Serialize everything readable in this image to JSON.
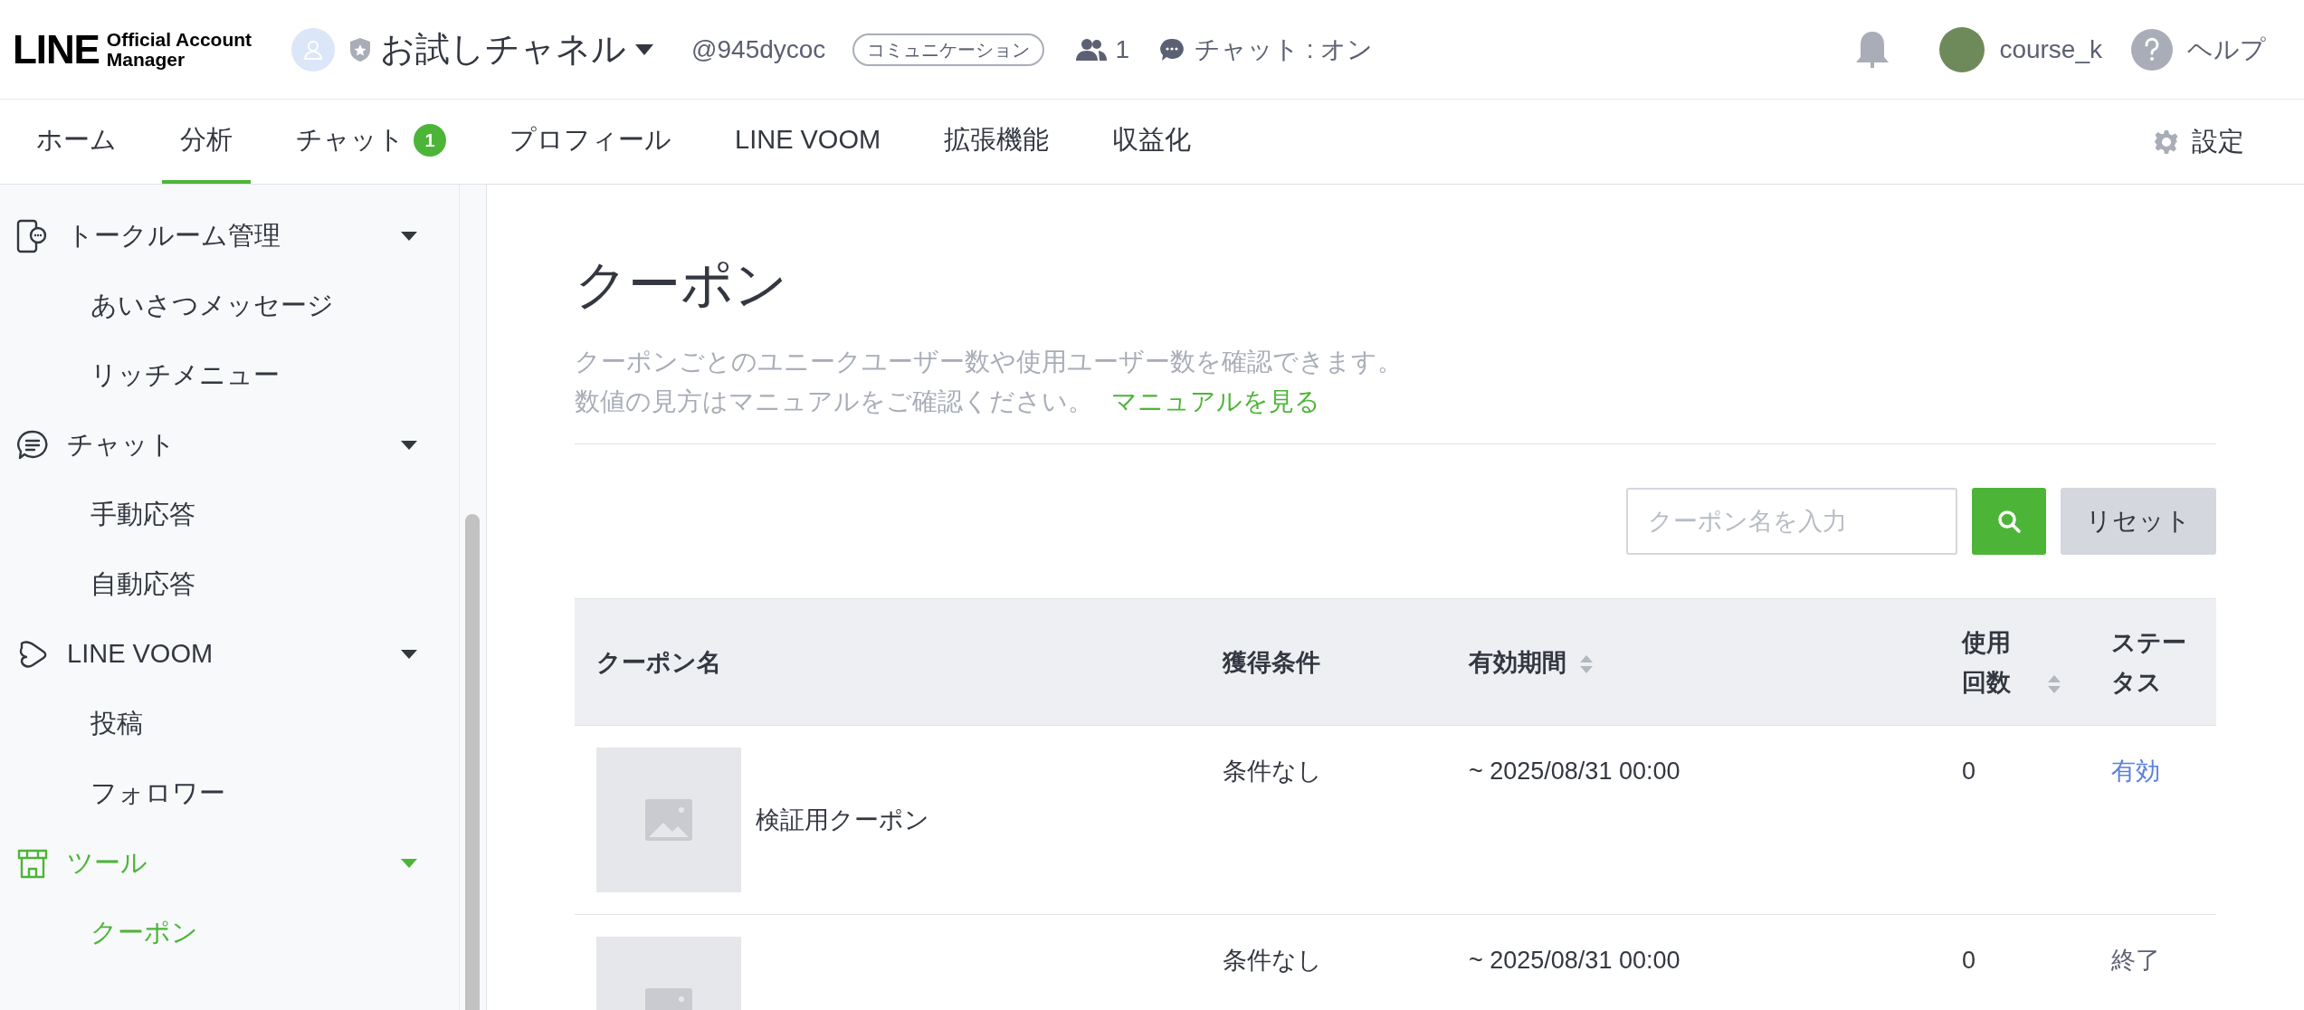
{
  "header": {
    "logo": {
      "mark": "LINE",
      "line1": "Official Account",
      "line2": "Manager"
    },
    "account": {
      "name": "お試しチャネル",
      "id": "@945dycoc",
      "plan": "コミュニケーション"
    },
    "friends": "1",
    "chat_status": "チャット : オン",
    "user": "course_k",
    "help": "ヘルプ"
  },
  "nav": {
    "tabs": [
      {
        "label": "ホーム",
        "selected": false
      },
      {
        "label": "分析",
        "selected": true
      },
      {
        "label": "チャット",
        "selected": false,
        "badge": "1"
      },
      {
        "label": "プロフィール",
        "selected": false
      },
      {
        "label": "LINE VOOM",
        "selected": false
      },
      {
        "label": "拡張機能",
        "selected": false
      },
      {
        "label": "収益化",
        "selected": false
      }
    ],
    "settings": "設定"
  },
  "sidebar": {
    "groups": [
      {
        "label": "トークルーム管理",
        "expanded": true,
        "selected": false,
        "children": [
          {
            "label": "あいさつメッセージ",
            "selected": false
          },
          {
            "label": "リッチメニュー",
            "selected": false
          }
        ]
      },
      {
        "label": "チャット",
        "expanded": true,
        "selected": false,
        "children": [
          {
            "label": "手動応答",
            "selected": false
          },
          {
            "label": "自動応答",
            "selected": false
          }
        ]
      },
      {
        "label": "LINE VOOM",
        "expanded": true,
        "selected": false,
        "children": [
          {
            "label": "投稿",
            "selected": false
          },
          {
            "label": "フォロワー",
            "selected": false
          }
        ]
      },
      {
        "label": "ツール",
        "expanded": true,
        "selected": true,
        "children": [
          {
            "label": "クーポン",
            "selected": true
          }
        ]
      }
    ]
  },
  "page": {
    "title": "クーポン",
    "description": [
      "クーポンごとのユニークユーザー数や使用ユーザー数を確認できます。",
      "数値の見方はマニュアルをご確認ください。"
    ],
    "link": "マニュアルを見る",
    "search": {
      "placeholder": "クーポン名を入力",
      "reset": "リセット"
    },
    "table": {
      "columns": [
        {
          "label": "クーポン名",
          "sortable": false
        },
        {
          "label": "獲得条件",
          "sortable": false
        },
        {
          "label": "有効期間",
          "sortable": true
        },
        {
          "label": "使用回数",
          "sortable": true
        },
        {
          "label": "ステータス",
          "sortable": false
        }
      ],
      "rows": [
        {
          "name": "検証用クーポン",
          "condition": "条件なし",
          "period": "~ 2025/08/31 00:00",
          "uses": "0",
          "status": "有効",
          "color": "#5a7fe0"
        },
        {
          "condition": "条件なし",
          "period": "~ 2025/08/31 00:00",
          "uses": "0",
          "status": "終了",
          "color": "#5b6072"
        }
      ]
    }
  }
}
